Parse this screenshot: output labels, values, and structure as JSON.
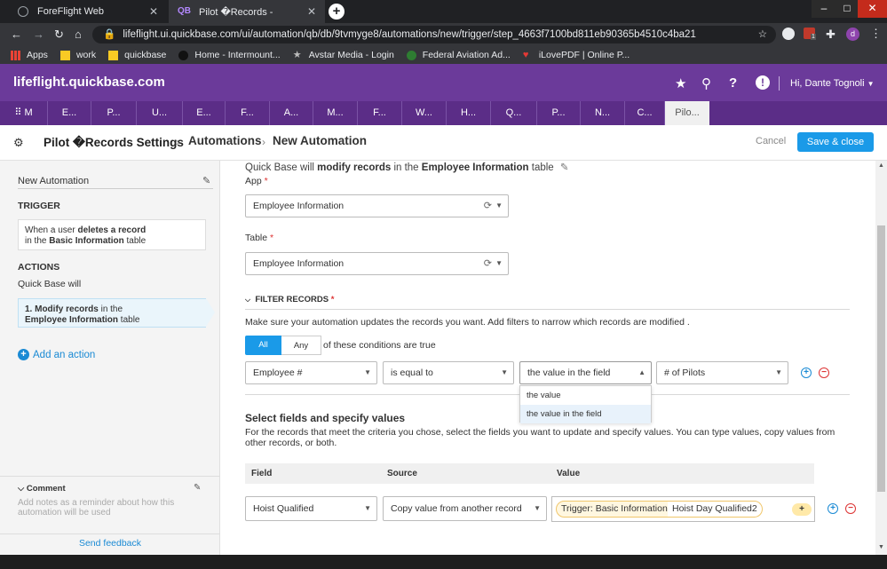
{
  "browser": {
    "tabs": [
      {
        "title": "ForeFlight Web",
        "active": false
      },
      {
        "title": "Pilot �Records -",
        "active": true
      }
    ],
    "url": "lifeflight.ui.quickbase.com/ui/automation/qb/db/9tvmyge8/automations/new/trigger/step_4663f7100bd811eb90365b4510c4ba21",
    "bookmarks": [
      "Apps",
      "work",
      "quickbase",
      "Home - Intermount...",
      "Avstar Media - Login",
      "Federal Aviation Ad...",
      "iLovePDF | Online P..."
    ],
    "profile_initial": "d",
    "ext_badge": "1"
  },
  "qb": {
    "brand": "lifeflight.quickbase.com",
    "user": "Hi, Dante Tognoli",
    "app_tabs": [
      {
        "label": "M",
        "active": false
      },
      {
        "label": "E...",
        "active": false
      },
      {
        "label": "P...",
        "active": false
      },
      {
        "label": "U...",
        "active": false
      },
      {
        "label": "E...",
        "active": false
      },
      {
        "label": "F...",
        "active": false
      },
      {
        "label": "A...",
        "active": false
      },
      {
        "label": "M...",
        "active": false
      },
      {
        "label": "F...",
        "active": false
      },
      {
        "label": "W...",
        "active": false
      },
      {
        "label": "H...",
        "active": false
      },
      {
        "label": "Q...",
        "active": false
      },
      {
        "label": "P...",
        "active": false
      },
      {
        "label": "N...",
        "active": false
      },
      {
        "label": "C...",
        "active": false
      },
      {
        "label": "Pilo...",
        "active": true
      }
    ]
  },
  "page": {
    "breadcrumb": [
      "Pilot �Records Settings",
      "Automations",
      "New Automation"
    ],
    "cancel_label": "Cancel",
    "save_label": "Save & close"
  },
  "sidebar": {
    "automation_name": "New Automation",
    "trigger_heading": "TRIGGER",
    "trigger_card": {
      "pre": "When a user ",
      "action": "deletes a record",
      "mid": "in the ",
      "table": "Basic Information",
      "post": " table"
    },
    "actions_heading": "ACTIONS",
    "actions_intro": "Quick Base will",
    "action_card": {
      "pre": "1. Modify records",
      "mid": " in the",
      "table": "Employee Information",
      "post": " table"
    },
    "add_action": "Add an action",
    "comment_heading": "Comment",
    "comment_placeholder": "Add notes as a reminder about how this automation will be used",
    "feedback": "Send feedback"
  },
  "main": {
    "intro": {
      "pre": "Quick Base will ",
      "verb": "modify records",
      "mid": " in the ",
      "table": "Employee Information",
      "post": " table"
    },
    "app_label": "App",
    "app_value": "Employee Information",
    "table_label": "Table",
    "table_value": "Employee Information",
    "filter_heading": "FILTER RECORDS",
    "filter_help": "Make sure your automation updates the records you want. Add filters to narrow which records are modified .",
    "match_all": "All",
    "match_any": "Any",
    "match_suffix": "of these conditions are true",
    "condition": {
      "field": "Employee #",
      "operator": "is equal to",
      "value_type": "the value in the field",
      "value": "# of Pilots"
    },
    "value_type_options": [
      "the value",
      "the value in the field"
    ],
    "select_heading": "Select fields and specify values",
    "select_help": "For the records that meet the criteria you chose, select the fields you want to update and specify values. You can type values, copy values from other records, or both.",
    "table_headers": [
      "Field",
      "Source",
      "Value"
    ],
    "row": {
      "field": "Hoist Qualified",
      "source": "Copy value from another record",
      "token_trigger": "Trigger: Basic Information",
      "token_field": "Hoist Day Qualified2"
    }
  },
  "colors": {
    "qb_purple": "#6b3a9a",
    "tab_purple": "#5b2d87",
    "accent_blue": "#1a9ae8",
    "token_yellow": "#fff7e0"
  }
}
